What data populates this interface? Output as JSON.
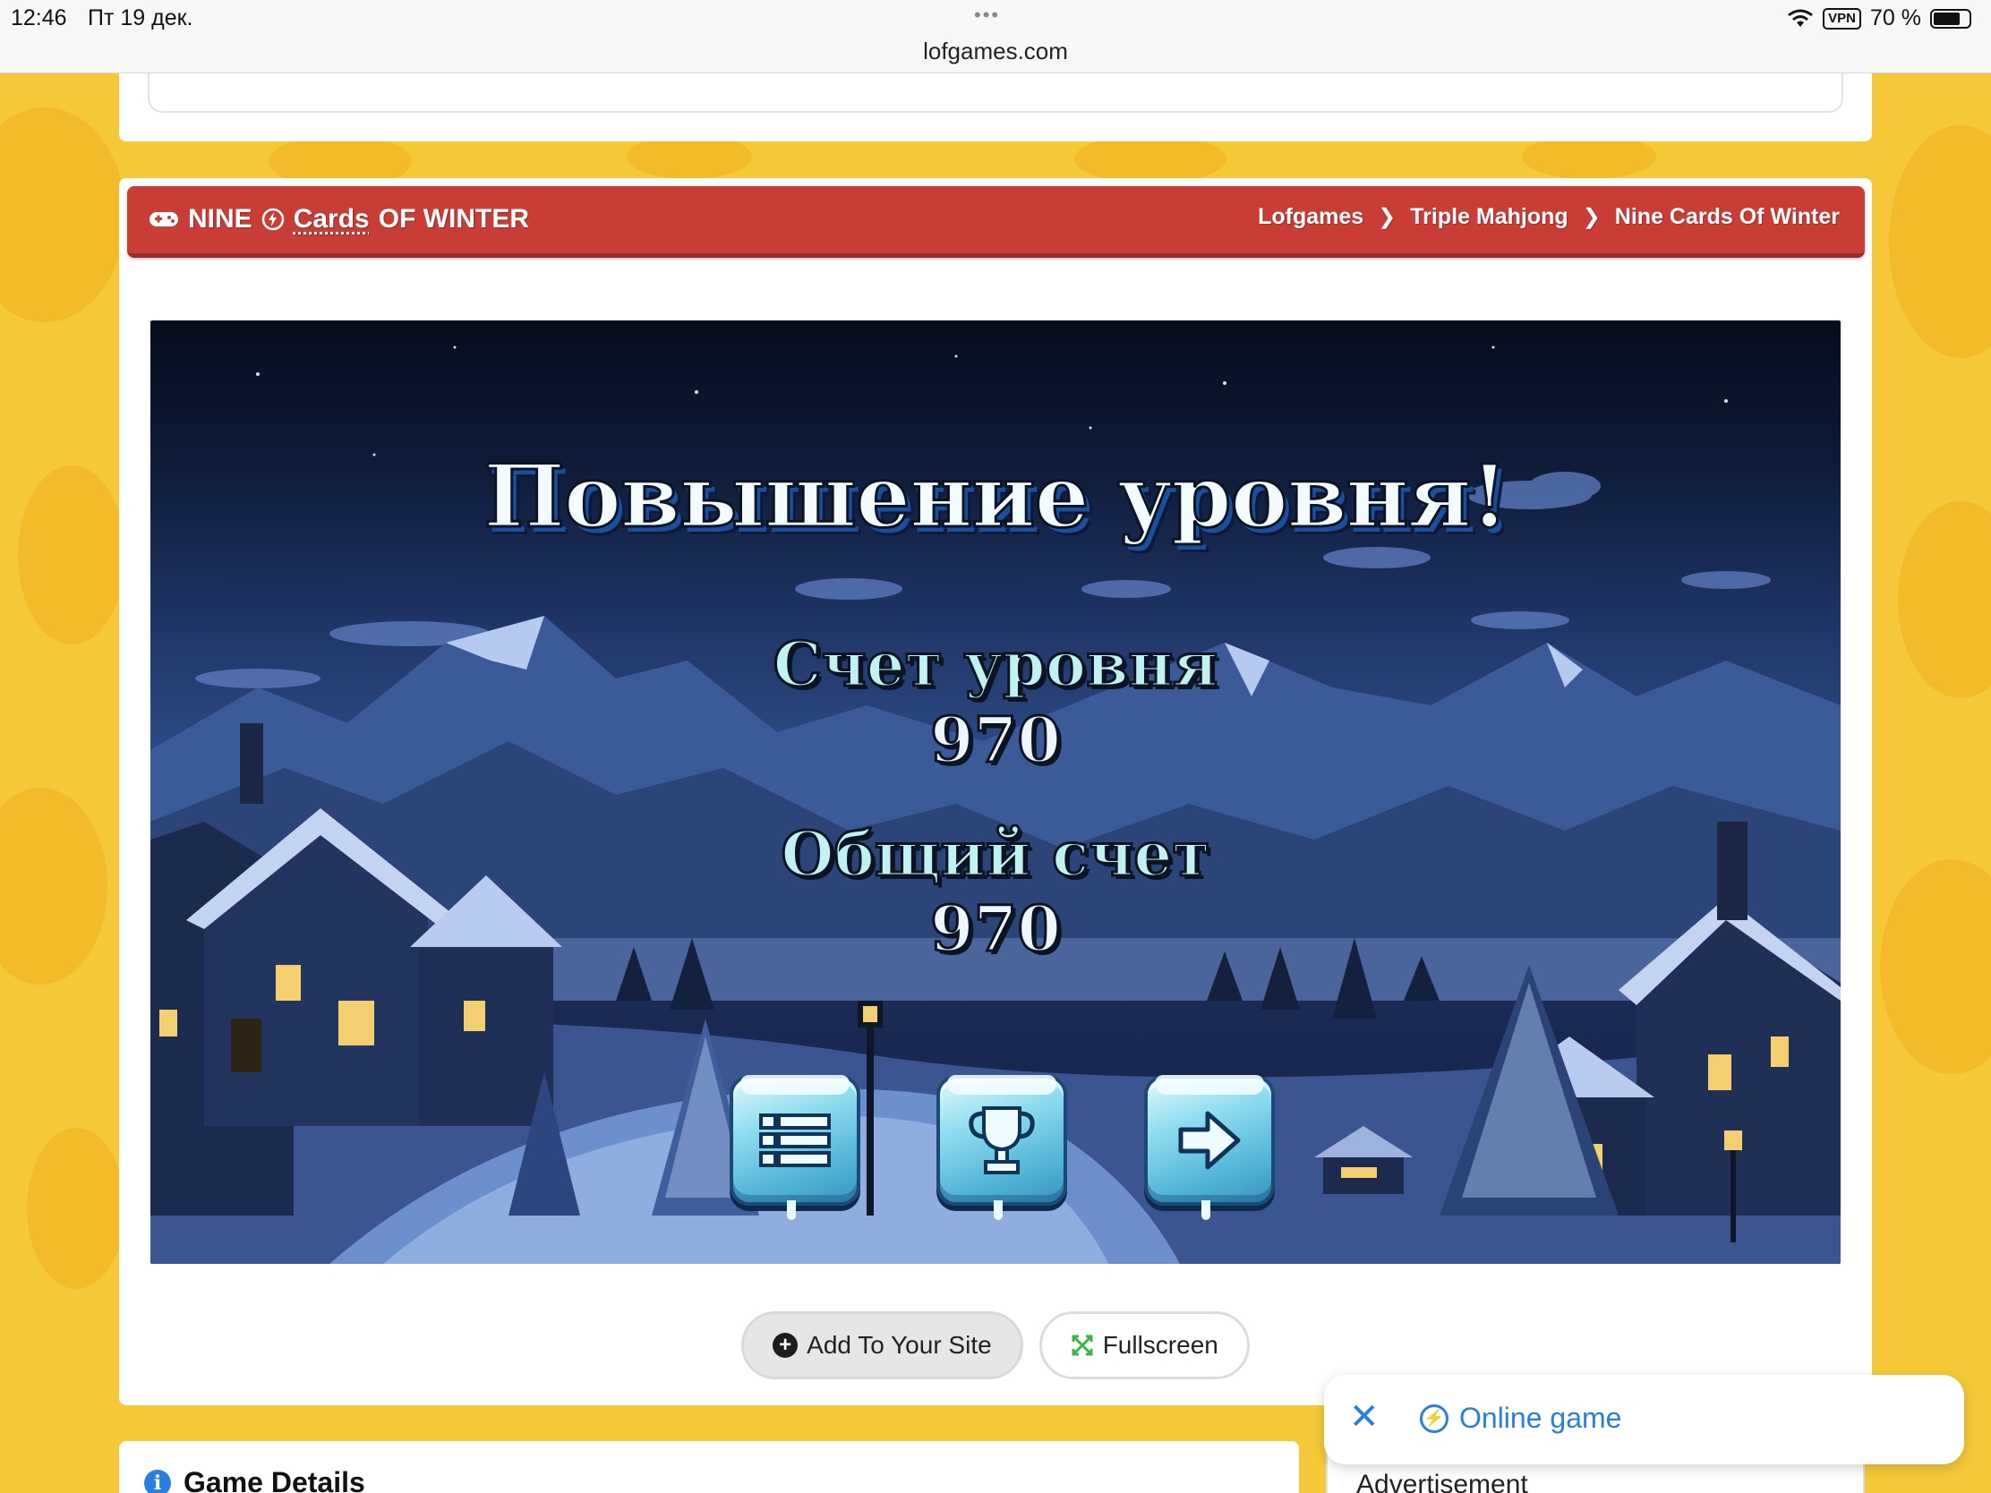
{
  "status_bar": {
    "time": "12:46",
    "date": "Пт 19 дек.",
    "dots": "•••",
    "url": "lofgames.com",
    "vpn": "VPN",
    "battery": "70 %",
    "battery_level": 0.7
  },
  "header": {
    "title_part1": "NINE",
    "title_part2": "Cards",
    "title_part3": "OF WINTER",
    "breadcrumbs": [
      "Lofgames",
      "Triple Mahjong",
      "Nine Cards Of Winter"
    ],
    "accent_color": "#c93d36"
  },
  "game": {
    "title": "Повышение уровня!",
    "level_score_label": "Счет уровня",
    "level_score": "970",
    "total_score_label": "Общий счет",
    "total_score": "970",
    "buttons": [
      "menu-icon",
      "trophy-icon",
      "arrow-right-icon"
    ]
  },
  "actions": {
    "add_label": "Add To Your Site",
    "fullscreen_label": "Fullscreen"
  },
  "details": {
    "title": "Game Details"
  },
  "ad": {
    "label": "Advertisement"
  },
  "floating": {
    "close": "✕",
    "online_label": "Online game",
    "link_color": "#2a7de1"
  }
}
